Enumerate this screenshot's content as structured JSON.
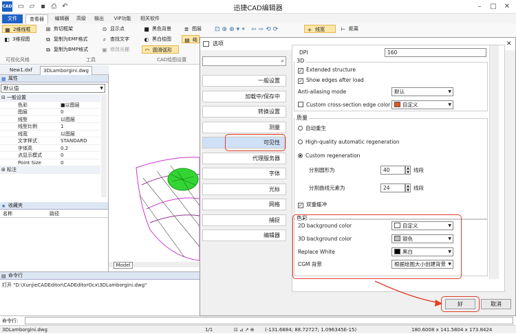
{
  "app": {
    "title": "迅捷CAD编辑器",
    "icon_text": "CAD"
  },
  "tabs": [
    "文件",
    "查看器",
    "编辑器",
    "高级",
    "输出",
    "VIP功能",
    "相关软件"
  ],
  "ribbon": {
    "col1": [
      "2维线框",
      "3维视图"
    ],
    "col2": [
      "剪切框架",
      "复制为EMF格式",
      "复制为BMP格式"
    ],
    "col3": [
      "显示点",
      "查找文字",
      "修改光栅"
    ],
    "col4": [
      "黑色背景",
      "黑白绘图",
      "圆滑弧形"
    ],
    "col5": [
      "图层",
      "结"
    ],
    "linewidth": "线宽",
    "distance": "距离",
    "groups": [
      "可视化风格",
      "工具",
      "CAD绘图设置"
    ]
  },
  "doc_tabs": [
    "New1.dxf",
    "3DLamborgini.dwg"
  ],
  "properties": {
    "title": "属性",
    "filter": "默认值",
    "section_general": "一般设置",
    "rows": [
      [
        "色彩",
        "■以图层"
      ],
      [
        "图层",
        "0"
      ],
      [
        "线型",
        "以图层"
      ],
      [
        "线型比例",
        "1"
      ],
      [
        "线宽",
        "以图层"
      ],
      [
        "文字样式",
        "STANDARD"
      ],
      [
        "字体高",
        "0.2"
      ],
      [
        "点显示模式",
        "0"
      ],
      [
        "Point Size",
        "0"
      ]
    ],
    "section_annotation": "标注"
  },
  "favorites": {
    "title": "收藏夹",
    "col_name": "名称",
    "col_path": "路径"
  },
  "model_tab": "Model",
  "command": {
    "title": "命令行",
    "log": "打开 \"D:\\XunjieCADEditor\\CADEditorOcx\\3DLamborgini.dwg\"",
    "input_label": "命令行:"
  },
  "status": {
    "file": "3DLamborgini.dwg",
    "page": "1/1",
    "coords": "(-131.6884; 88.72727; 1.096345E-15)",
    "size": "180.6008 x 141.5804 x 173.8424"
  },
  "dialog": {
    "title": "选项",
    "categories": [
      "一般设置",
      "加载中/保存中",
      "转换设置",
      "测量",
      "可见性",
      "代理服务器",
      "字体",
      "光标",
      "网格",
      "捕捉",
      "编辑器"
    ],
    "active_category": "可见性",
    "dpi_label": "DPI",
    "dpi_value": "160",
    "group_3d": "3D",
    "extended_structure": "Extended structure",
    "show_edges": "Show edges after load",
    "antialias_label": "Anti-aliasing mode",
    "antialias_value": "默认",
    "cross_edge_label": "Custom cross-section edge color",
    "cross_edge_value": "自定义",
    "group_quality": "质量",
    "radio_auto": "自动重生",
    "radio_hq": "High-quality automatic regeneration",
    "radio_custom": "Custom regeneration",
    "circle_seg_label": "分割圆形为",
    "circle_seg_value": "40",
    "circle_seg_unit": "线段",
    "curve_seg_label": "分割曲线元素为",
    "curve_seg_value": "24",
    "curve_seg_unit": "线段",
    "double_buffer": "双重缓冲",
    "group_color": "色彩",
    "bg2d_label": "2D background color",
    "bg2d_value": "自定义",
    "bg3d_label": "3D background color",
    "bg3d_value": "银色",
    "replace_white_label": "Replace White",
    "replace_white_value": "黑白",
    "cgm_label": "CGM 背景",
    "cgm_value": "根据绘图大小创建背景",
    "ok": "好",
    "cancel": "取消"
  },
  "colors": {
    "accent": "#1f62c4",
    "highlight": "#e0402a",
    "cross_edge": "#e8541c"
  }
}
